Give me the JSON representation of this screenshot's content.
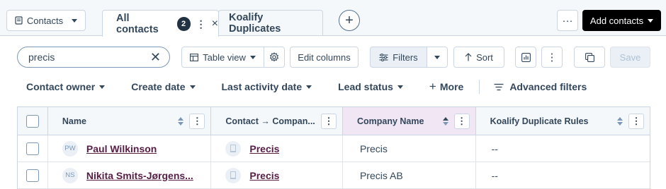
{
  "top_bar": {
    "object_selector_label": "Contacts",
    "tabs": [
      {
        "label": "All contacts",
        "count": "2",
        "more_glyph": "⋮",
        "close_glyph": "×"
      },
      {
        "label": "Koalify Duplicates"
      }
    ],
    "add_tab_glyph": "+",
    "more_actions_glyph": "···",
    "add_contacts_label": "Add contacts"
  },
  "toolbar": {
    "search_value": "precis",
    "clear_glyph": "✕",
    "table_view_label": "Table view",
    "edit_columns_label": "Edit columns",
    "filters_label": "Filters",
    "sort_label": "Sort",
    "kebab_glyph": "⋮",
    "save_label": "Save"
  },
  "quick_filters": {
    "items": [
      "Contact owner",
      "Create date",
      "Last activity date",
      "Lead status"
    ],
    "more_label": "More",
    "more_glyph": "+",
    "advanced_label": "Advanced filters"
  },
  "table": {
    "columns": [
      {
        "label": "Name"
      },
      {
        "label": "Contact → Compan..."
      },
      {
        "label": "Company Name"
      },
      {
        "label": "Koalify Duplicate Rules"
      }
    ],
    "column_menu_glyph": "⋮",
    "rows": [
      {
        "initials": "PW",
        "name": "Paul Wilkinson",
        "company_assoc": "Precis",
        "company_name": "Precis",
        "duplicate_rules": "--"
      },
      {
        "initials": "NS",
        "name": "Nikita Smits-Jørgens...",
        "company_assoc": "Precis",
        "company_name": "Precis AB",
        "duplicate_rules": "--"
      }
    ]
  },
  "colors": {
    "primary_text": "#33475b",
    "link": "#561d45",
    "sorted_column_bg": "#f0e6f4",
    "add_button_bg": "#000000"
  }
}
